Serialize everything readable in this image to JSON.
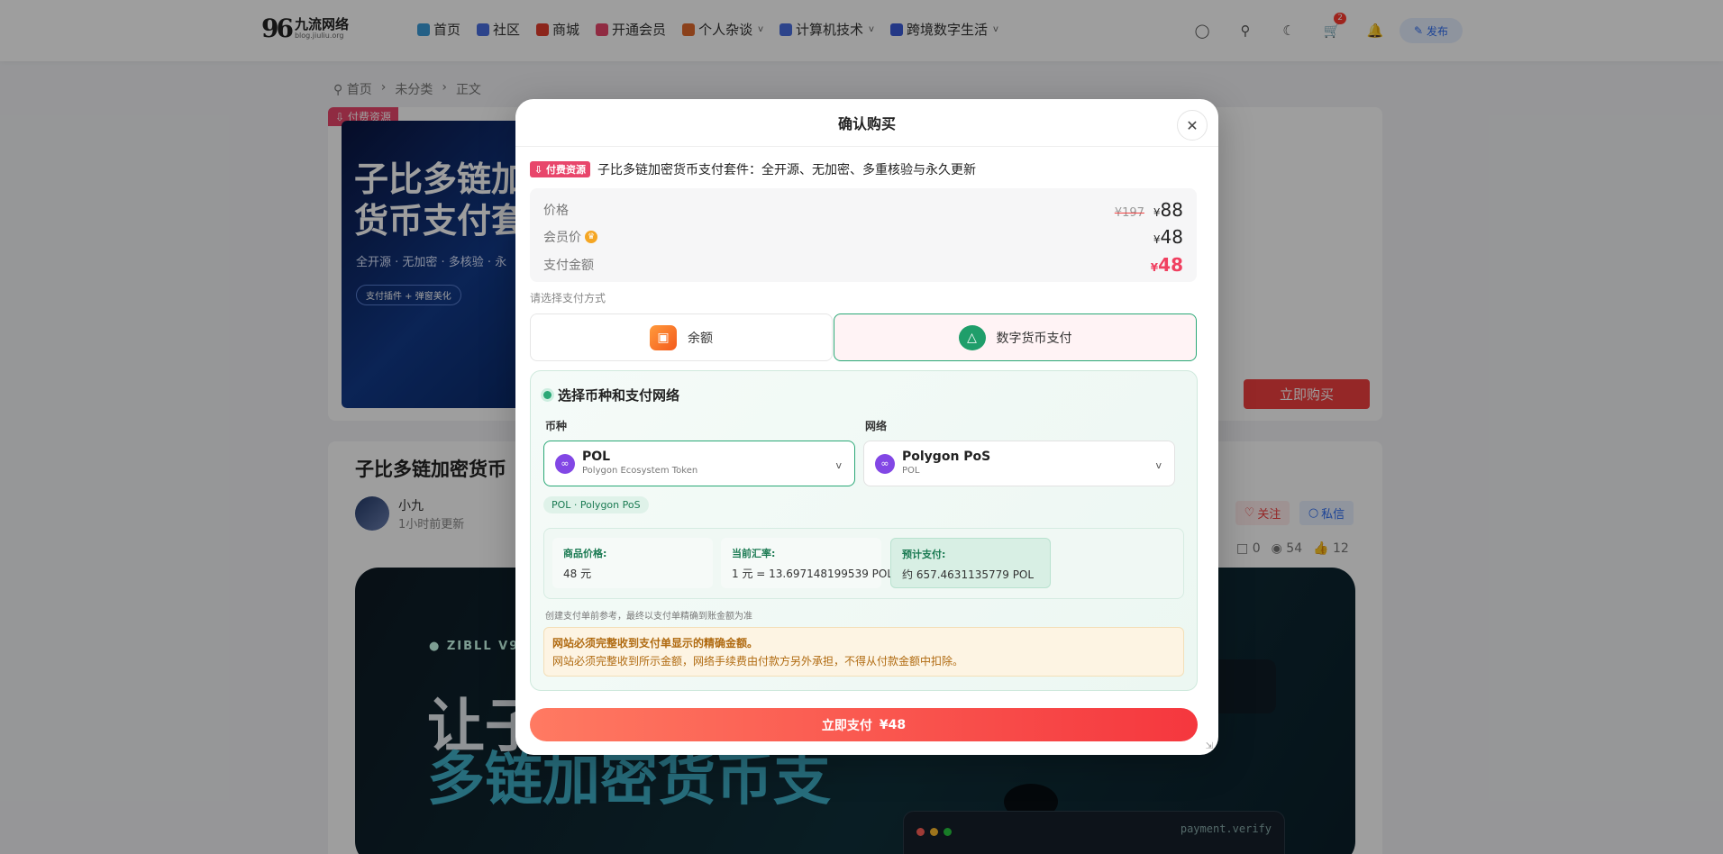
{
  "header": {
    "logo_mark": "96",
    "logo_name": "九流网络",
    "logo_sub": "blog.jiuliu.org",
    "nav": [
      {
        "label": "首页",
        "icon": "home-icon",
        "color": "#3a9bd8",
        "dropdown": false
      },
      {
        "label": "社区",
        "icon": "community-icon",
        "color": "#4a6ee0",
        "dropdown": false
      },
      {
        "label": "商城",
        "icon": "shop-icon",
        "color": "#e23c2c",
        "dropdown": false
      },
      {
        "label": "开通会员",
        "icon": "vip-icon",
        "color": "#e8466b",
        "dropdown": false
      },
      {
        "label": "个人杂谈",
        "icon": "chat-icon",
        "color": "#e06a2c",
        "dropdown": true
      },
      {
        "label": "计算机技术",
        "icon": "computer-icon",
        "color": "#4a6ee0",
        "dropdown": true
      },
      {
        "label": "跨境数字生活",
        "icon": "globe-icon",
        "color": "#3a5bd8",
        "dropdown": true
      }
    ],
    "cart_badge": "2",
    "publish_label": "发布"
  },
  "breadcrumb": {
    "home": "首页",
    "category": "未分类",
    "current": "正文"
  },
  "product_card": {
    "tag": "付费资源",
    "cover_title_line1": "子比多链加",
    "cover_title_line2": "货币支付套",
    "cover_subtitle": "全开源 · 无加密 · 多核验 · 永",
    "cover_chip": "支付插件 + 弹窗美化",
    "buy_label": "立即购买"
  },
  "article": {
    "title": "子比多链加密货币",
    "author": "小九",
    "updated": "1小时前更新",
    "follow_label": "关注",
    "message_label": "私信",
    "comments": "0",
    "views": "54",
    "likes": "12",
    "banner_tag": "ZIBLL V9 ·",
    "banner_line1": "让子",
    "banner_line2": "多链加密货币支",
    "banner_cmd": "payment.verify"
  },
  "modal": {
    "title": "确认购买",
    "product_tag": "付费资源",
    "product_name": "子比多链加密货币支付套件：全开源、无加密、多重核验与永久更新",
    "currency_symbol": "¥",
    "price_label": "价格",
    "original_price": "¥197",
    "price": "88",
    "member_label": "会员价",
    "member_price": "48",
    "pay_label": "支付金额",
    "pay_amount": "48",
    "method_label": "请选择支付方式",
    "method_balance": "余额",
    "method_crypto": "数字货币支付",
    "crypto_title": "选择币种和支付网络",
    "coin_label": "币种",
    "network_label": "网络",
    "coin_name": "POL",
    "coin_full": "Polygon Ecosystem Token",
    "network_name": "Polygon PoS",
    "network_sub": "POL",
    "chip": "POL · Polygon PoS",
    "goods_price_label": "商品价格:",
    "goods_price": "48 元",
    "rate_label": "当前汇率:",
    "rate": "1 元 = 13.697148199539 POL",
    "estimate_label": "预计支付:",
    "estimate": "约 657.4631135779 POL",
    "note": "创建支付单前参考，最终以支付单精确到账金额为准",
    "warn_title": "网站必须完整收到支付单显示的精确金额。",
    "warn_body": "网站必须完整收到所示金额，网络手续费由付款方另外承担，不得从付款金额中扣除。",
    "pay_button": "立即支付",
    "pay_button_amount": "¥48"
  }
}
